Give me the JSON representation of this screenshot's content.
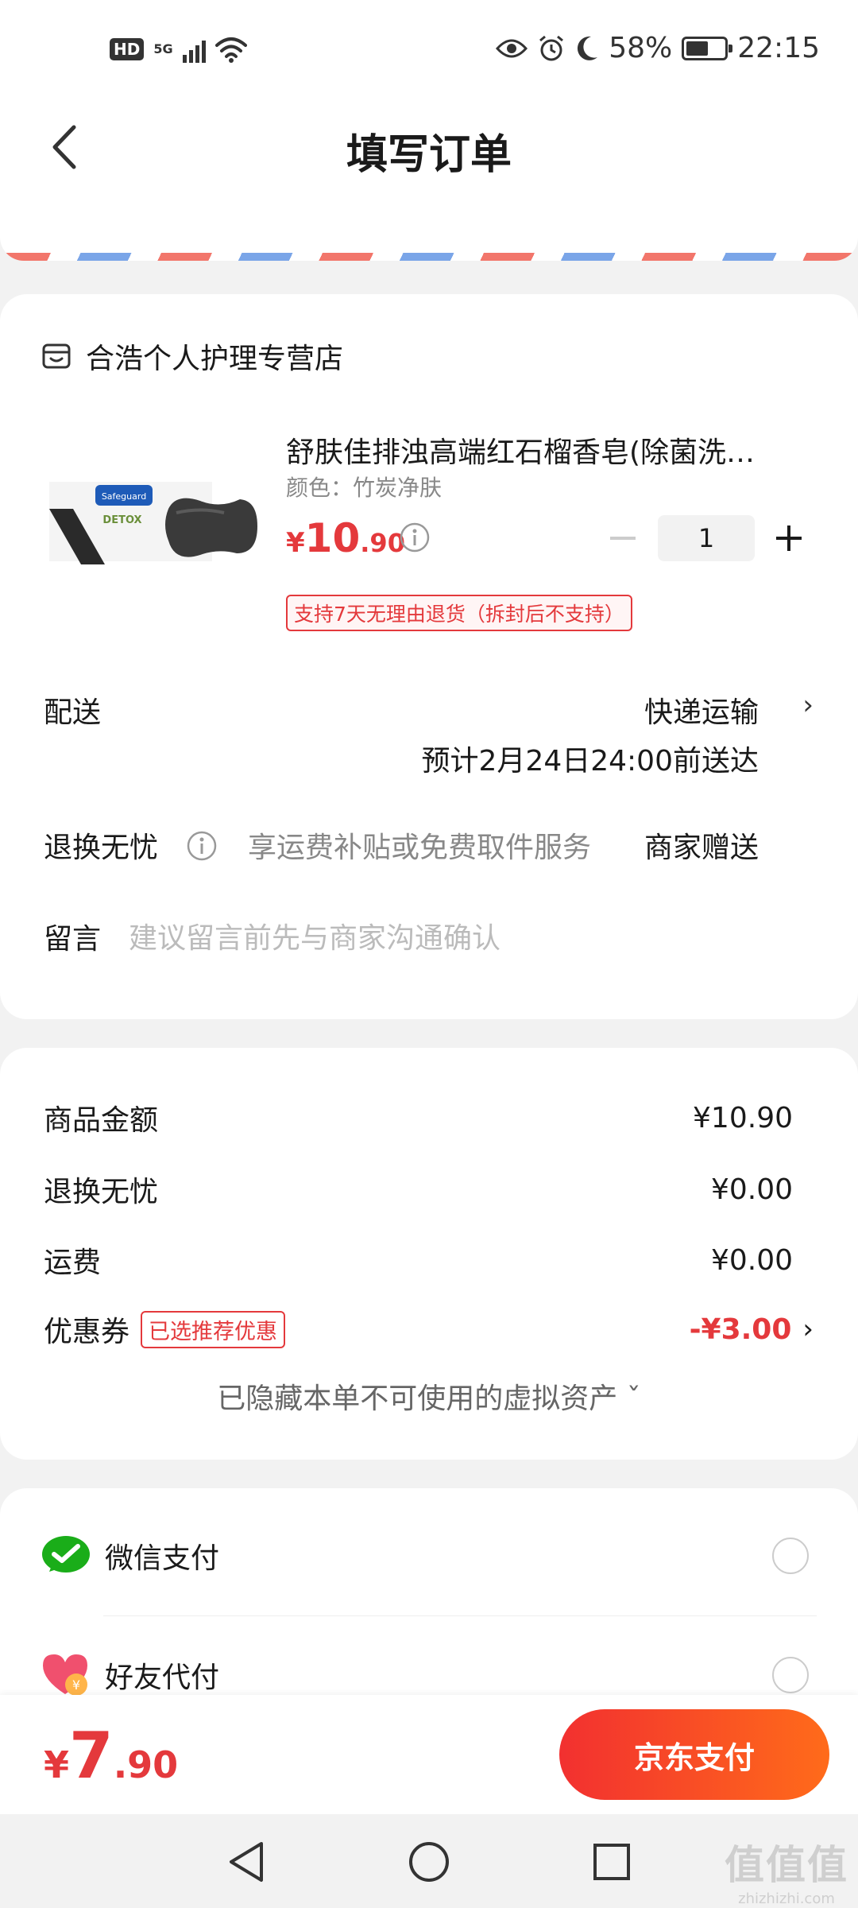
{
  "status_bar": {
    "hd": "HD",
    "network": "5G",
    "battery_percent": "58%",
    "battery_level": 0.58,
    "time": "22:15"
  },
  "header": {
    "title": "填写订单"
  },
  "order": {
    "shop_name": "合浩个人护理专营店",
    "product": {
      "title": "舒肤佳排浊高端红石榴香皂(除菌洗…",
      "spec": "颜色：竹炭净肤",
      "price_currency": "¥",
      "price_int": "10",
      "price_dec": ".90",
      "quantity": "1",
      "return_badge": "支持7天无理由退货（拆封后不支持）",
      "image_brand_text": "Safeguard",
      "image_label_text": "DETOX"
    },
    "delivery": {
      "label": "配送",
      "method": "快递运输",
      "eta": "预计2月24日24:00前送达"
    },
    "return_worry": {
      "label": "退换无忧",
      "desc": "享运费补贴或免费取件服务",
      "value": "商家赠送"
    },
    "message": {
      "label": "留言",
      "placeholder": "建议留言前先与商家沟通确认"
    }
  },
  "summary": {
    "goods_label": "商品金额",
    "goods_amount": "¥10.90",
    "return_label": "退换无忧",
    "return_amount": "¥0.00",
    "shipping_label": "运费",
    "shipping_amount": "¥0.00",
    "coupon_label": "优惠券",
    "coupon_badge": "已选推荐优惠",
    "coupon_amount": "-¥3.00",
    "hidden_assets": "已隐藏本单不可使用的虚拟资产 ˇ"
  },
  "payment": {
    "wechat_label": "微信支付",
    "friend_label": "好友代付"
  },
  "bottom_bar": {
    "total_currency": "¥",
    "total_int": "7",
    "total_dec": ".90",
    "pay_button": "京东支付"
  },
  "watermark": {
    "main": "值值值",
    "sub": "zhizhizhi.com"
  },
  "colors": {
    "accent_red": "#e4393c",
    "wechat_green": "#1aad19"
  }
}
